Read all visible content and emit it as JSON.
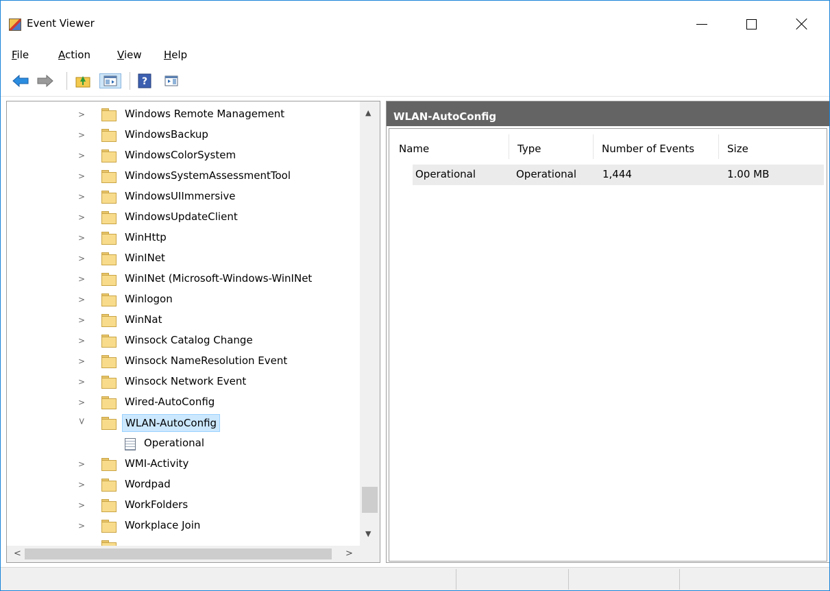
{
  "window": {
    "title": "Event Viewer",
    "accent_border": "#1883d7"
  },
  "menu": {
    "items": [
      {
        "label": "File",
        "mnemonic": "F"
      },
      {
        "label": "Action",
        "mnemonic": "A"
      },
      {
        "label": "View",
        "mnemonic": "V"
      },
      {
        "label": "Help",
        "mnemonic": "H"
      }
    ]
  },
  "toolbar": {
    "buttons": [
      {
        "name": "back-arrow-icon"
      },
      {
        "name": "forward-arrow-icon"
      },
      {
        "name": "up-folder-icon"
      },
      {
        "name": "show-hide-tree-icon",
        "pressed": true
      },
      {
        "name": "help-icon"
      },
      {
        "name": "show-hide-action-pane-icon"
      }
    ]
  },
  "tree": {
    "items": [
      {
        "label": "Windows Remote Management",
        "expanded": false
      },
      {
        "label": "WindowsBackup",
        "expanded": false
      },
      {
        "label": "WindowsColorSystem",
        "expanded": false
      },
      {
        "label": "WindowsSystemAssessmentTool",
        "expanded": false
      },
      {
        "label": "WindowsUIImmersive",
        "expanded": false
      },
      {
        "label": "WindowsUpdateClient",
        "expanded": false
      },
      {
        "label": "WinHttp",
        "expanded": false
      },
      {
        "label": "WinINet",
        "expanded": false
      },
      {
        "label": "WinINet (Microsoft-Windows-WinINet",
        "expanded": false
      },
      {
        "label": "Winlogon",
        "expanded": false
      },
      {
        "label": "WinNat",
        "expanded": false
      },
      {
        "label": "Winsock Catalog Change",
        "expanded": false
      },
      {
        "label": "Winsock NameResolution Event",
        "expanded": false
      },
      {
        "label": "Winsock Network Event",
        "expanded": false
      },
      {
        "label": "Wired-AutoConfig",
        "expanded": false
      },
      {
        "label": "WLAN-AutoConfig",
        "expanded": true,
        "selected": true
      },
      {
        "label": "Operational",
        "child": true
      },
      {
        "label": "WMI-Activity",
        "expanded": false
      },
      {
        "label": "Wordpad",
        "expanded": false
      },
      {
        "label": "WorkFolders",
        "expanded": false
      },
      {
        "label": "Workplace Join",
        "expanded": false
      }
    ]
  },
  "details": {
    "header": "WLAN-AutoConfig",
    "columns": [
      "Name",
      "Type",
      "Number of Events",
      "Size"
    ],
    "rows": [
      [
        "Operational",
        "Operational",
        "1,444",
        "1.00 MB"
      ]
    ]
  },
  "colors": {
    "pane_header_bg": "#646464",
    "selection_bg": "#cce8ff",
    "row_bg": "#ebebeb"
  }
}
